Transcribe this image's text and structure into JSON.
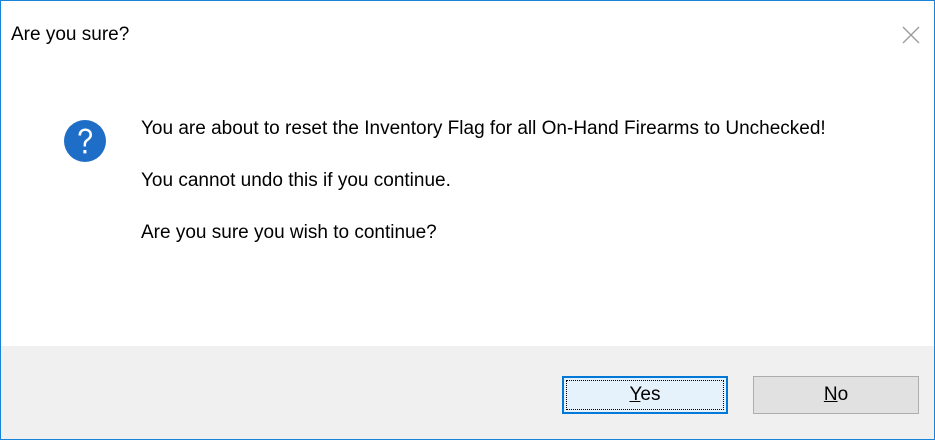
{
  "dialog": {
    "title": "Are you sure?",
    "icon": "question-icon",
    "message": {
      "line1": "You are about to reset the Inventory Flag for all On-Hand Firearms to Unchecked!",
      "line2": "You cannot undo this if you continue.",
      "line3": "Are you sure you wish to continue?"
    },
    "buttons": {
      "yes_accel": "Y",
      "yes_rest": "es",
      "no_accel": "N",
      "no_rest": "o"
    }
  },
  "colors": {
    "window_border": "#1883d7",
    "icon_blue": "#1e6ec8",
    "footer_bg": "#f0f0f0",
    "focused_button_border": "#0078d7"
  }
}
